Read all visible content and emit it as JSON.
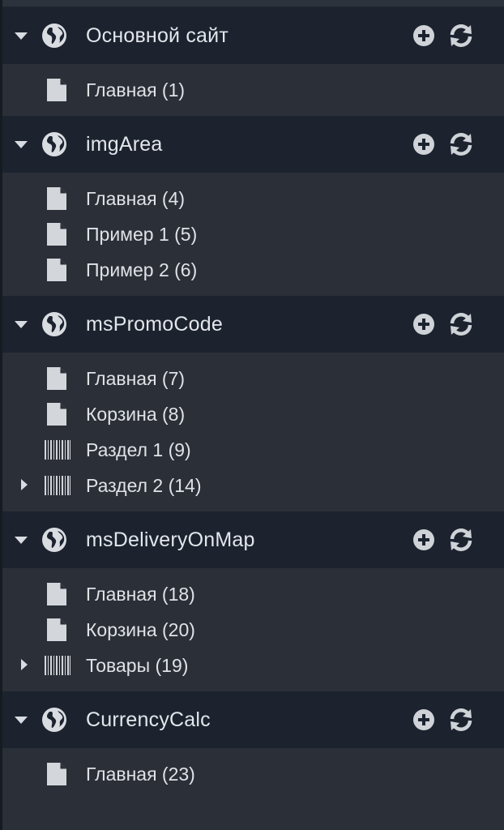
{
  "contexts": [
    {
      "name": "Основной сайт",
      "items": [
        {
          "label": "Главная (1)",
          "type": "document",
          "expandable": false
        }
      ]
    },
    {
      "name": "imgArea",
      "items": [
        {
          "label": "Главная (4)",
          "type": "document",
          "expandable": false
        },
        {
          "label": "Пример 1 (5)",
          "type": "document",
          "expandable": false
        },
        {
          "label": "Пример 2 (6)",
          "type": "document",
          "expandable": false
        }
      ]
    },
    {
      "name": "msPromoCode",
      "items": [
        {
          "label": "Главная (7)",
          "type": "document",
          "expandable": false
        },
        {
          "label": "Корзина (8)",
          "type": "document",
          "expandable": false
        },
        {
          "label": "Раздел 1 (9)",
          "type": "category",
          "expandable": false
        },
        {
          "label": "Раздел 2 (14)",
          "type": "category",
          "expandable": true
        }
      ]
    },
    {
      "name": "msDeliveryOnMap",
      "items": [
        {
          "label": "Главная (18)",
          "type": "document",
          "expandable": false
        },
        {
          "label": "Корзина (20)",
          "type": "document",
          "expandable": false
        },
        {
          "label": "Товары (19)",
          "type": "category",
          "expandable": true
        }
      ]
    },
    {
      "name": "CurrencyCalc",
      "items": [
        {
          "label": "Главная (23)",
          "type": "document",
          "expandable": false
        }
      ]
    }
  ],
  "icons": {
    "context": "globe-icon",
    "add": "plus-circle-icon",
    "refresh": "refresh-icon",
    "document": "document-icon",
    "category": "barcode-icon",
    "collapse": "caret-down-icon",
    "expand": "caret-right-icon"
  },
  "colors": {
    "context_bg": "#1c232f",
    "tree_bg": "#2a2f38",
    "text": "#e3e6ea",
    "icon": "#d8dce2"
  }
}
